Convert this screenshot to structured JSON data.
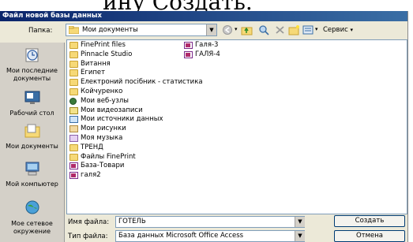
{
  "backdrop_caption": "ину Создать.",
  "window": {
    "title": "Файл новой базы данных"
  },
  "lookin": {
    "label": "Папка:",
    "value": "Мои документы"
  },
  "toolbar": {
    "tools_label": "Сервис"
  },
  "places": [
    {
      "label": "Мои последние документы",
      "icon": "recent-docs-icon"
    },
    {
      "label": "Рабочий стол",
      "icon": "desktop-icon"
    },
    {
      "label": "Мои документы",
      "icon": "my-documents-icon"
    },
    {
      "label": "Мой компьютер",
      "icon": "my-computer-icon"
    },
    {
      "label": "Мое сетевое окружение",
      "icon": "network-icon"
    }
  ],
  "files_col1": [
    {
      "name": "FinePrint files",
      "type": "folder"
    },
    {
      "name": "Pinnacle Studio",
      "type": "folder"
    },
    {
      "name": "Витання",
      "type": "folder"
    },
    {
      "name": "Египет",
      "type": "folder"
    },
    {
      "name": "Електроний посібник - статистика",
      "type": "folder"
    },
    {
      "name": "Койчуренко",
      "type": "folder"
    },
    {
      "name": "Мои веб-узлы",
      "type": "web"
    },
    {
      "name": "Мои видеозаписи",
      "type": "video"
    },
    {
      "name": "Мои источники данных",
      "type": "src"
    },
    {
      "name": "Мои рисунки",
      "type": "pics"
    },
    {
      "name": "Моя музыка",
      "type": "music"
    },
    {
      "name": "ТРЕНД",
      "type": "folder"
    },
    {
      "name": "Файлы FinePrint",
      "type": "folder"
    },
    {
      "name": "База-Товари",
      "type": "access"
    },
    {
      "name": "галя2",
      "type": "access"
    }
  ],
  "files_col2": [
    {
      "name": "Галя-3",
      "type": "access"
    },
    {
      "name": "ГАЛЯ-4",
      "type": "access"
    }
  ],
  "filename": {
    "label": "Имя файла:",
    "value": "ГОТЕЛЬ"
  },
  "filetype": {
    "label": "Тип файла:",
    "value": "База данных Microsoft Office Access"
  },
  "buttons": {
    "create": "Создать",
    "cancel": "Отмена"
  }
}
